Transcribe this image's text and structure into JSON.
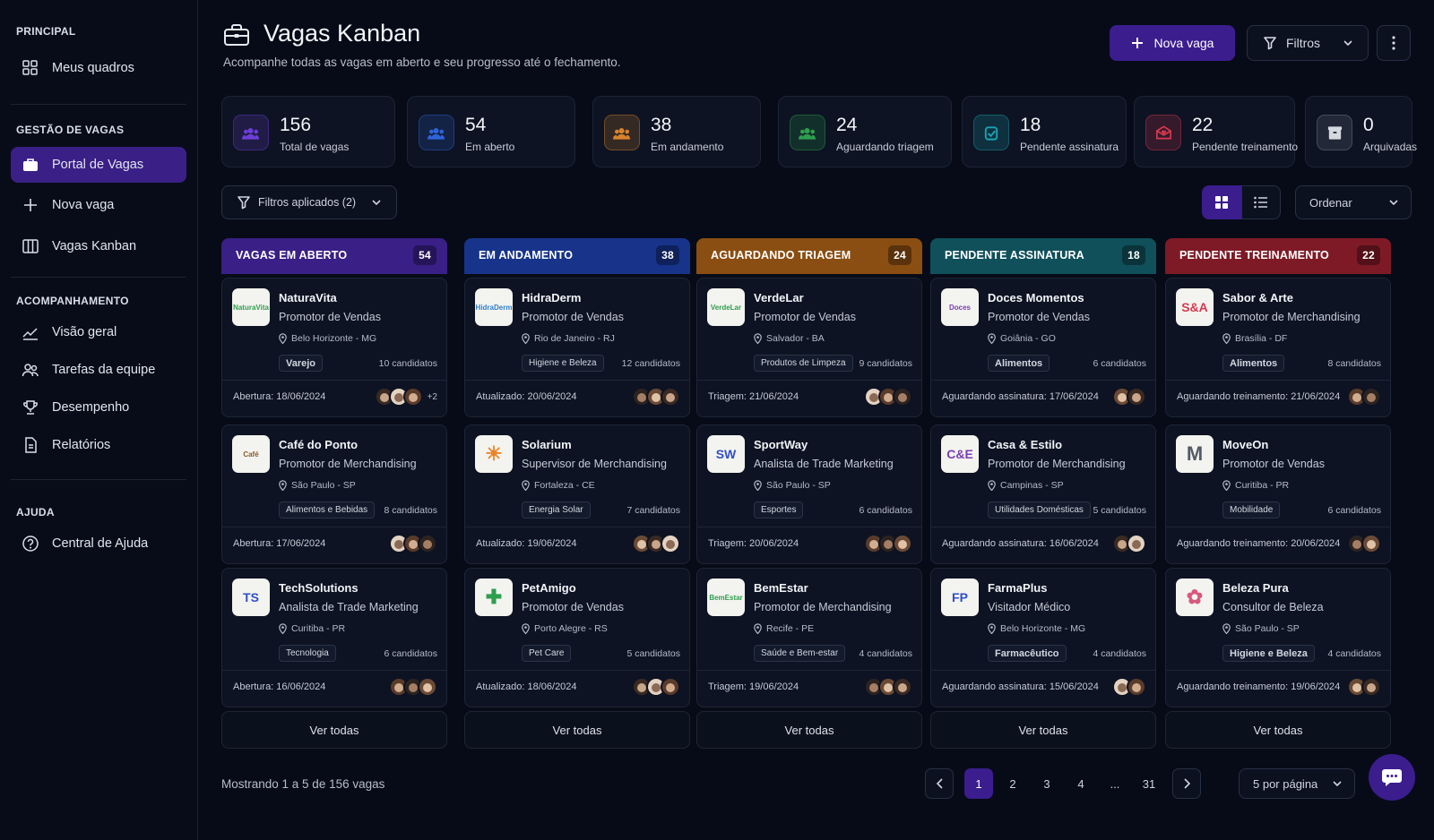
{
  "sidebar": {
    "sections": [
      {
        "title": "PRINCIPAL",
        "items": [
          {
            "label": "Meus quadros",
            "icon": "grid-icon"
          }
        ]
      },
      {
        "title": "GESTÃO DE VAGAS",
        "items": [
          {
            "label": "Portal de Vagas",
            "icon": "briefcase-icon",
            "active": true
          },
          {
            "label": "Nova vaga",
            "icon": "plus-icon"
          },
          {
            "label": "Vagas Kanban",
            "icon": "kanban-icon"
          }
        ]
      },
      {
        "title": "ACOMPANHAMENTO",
        "items": [
          {
            "label": "Visão geral",
            "icon": "chart-line-icon"
          },
          {
            "label": "Tarefas da equipe",
            "icon": "team-icon"
          },
          {
            "label": "Desempenho",
            "icon": "trophy-icon"
          },
          {
            "label": "Relatórios",
            "icon": "report-icon"
          }
        ]
      },
      {
        "title": "AJUDA",
        "items": [
          {
            "label": "Central de Ajuda",
            "icon": "help-circle-icon"
          }
        ]
      }
    ]
  },
  "header": {
    "title": "Vagas Kanban",
    "subtitle": "Acompanhe todas as vagas em aberto e seu progresso até o fechamento.",
    "new_button": "Nova vaga",
    "filter_button": "Filtros"
  },
  "stats": [
    {
      "value": "156",
      "label": "Total de vagas",
      "color": "#6c3fd6"
    },
    {
      "value": "54",
      "label": "Em aberto",
      "color": "#2f63d8"
    },
    {
      "value": "38",
      "label": "Em andamento",
      "color": "#d9822b"
    },
    {
      "value": "24",
      "label": "Aguardando triagem",
      "color": "#2e9e4f"
    },
    {
      "value": "18",
      "label": "Pendente assinatura",
      "color": "#1aa3b5"
    },
    {
      "value": "22",
      "label": "Pendente treinamento",
      "color": "#d8384f"
    },
    {
      "value": "0",
      "label": "Arquivadas",
      "color": "#7a7f8c"
    }
  ],
  "toolbar": {
    "applied_filters": "Filtros aplicados (2)",
    "sort": "Ordenar"
  },
  "columns": [
    {
      "title": "VAGAS EM ABERTO",
      "count": "54",
      "color": "#3a1f86",
      "cards": [
        {
          "company": "NaturaVita",
          "role": "Promotor de Vendas",
          "location": "Belo Horizonte - MG",
          "tag": "Varejo",
          "bold_tag": true,
          "candidates": "10 candidatos",
          "date": "Abertura: 18/06/2024",
          "extra": "+2",
          "logo_text": "NaturaVita",
          "logo_color": "#2e9e4f"
        },
        {
          "company": "Café do Ponto",
          "role": "Promotor de Merchandising",
          "location": "São Paulo - SP",
          "tag": "Alimentos e Bebidas",
          "bold_tag": false,
          "candidates": "8 candidatos",
          "date": "Abertura: 17/06/2024",
          "extra": "",
          "logo_text": "Café",
          "logo_color": "#8a5a2b"
        },
        {
          "company": "TechSolutions",
          "role": "Analista de Trade Marketing",
          "location": "Curitiba - PR",
          "tag": "Tecnologia",
          "bold_tag": false,
          "candidates": "6 candidatos",
          "date": "Abertura: 16/06/2024",
          "extra": "",
          "logo_text": "TS",
          "logo_color": "#2f4fc8"
        }
      ]
    },
    {
      "title": "EM ANDAMENTO",
      "count": "38",
      "color": "#17348a",
      "cards": [
        {
          "company": "HidraDerm",
          "role": "Promotor de Vendas",
          "location": "Rio de Janeiro - RJ",
          "tag": "Higiene e Beleza",
          "bold_tag": false,
          "candidates": "12 candidatos",
          "date": "Atualizado: 20/06/2024",
          "extra": "",
          "logo_text": "HidraDerm",
          "logo_color": "#2f7fc8"
        },
        {
          "company": "Solarium",
          "role": "Supervisor de Merchandising",
          "location": "Fortaleza - CE",
          "tag": "Energia Solar",
          "bold_tag": false,
          "candidates": "7 candidatos",
          "date": "Atualizado: 19/06/2024",
          "extra": "",
          "logo_text": "☀",
          "logo_color": "#e8862a"
        },
        {
          "company": "PetAmigo",
          "role": "Promotor de Vendas",
          "location": "Porto Alegre - RS",
          "tag": "Pet Care",
          "bold_tag": false,
          "candidates": "5 candidatos",
          "date": "Atualizado: 18/06/2024",
          "extra": "",
          "logo_text": "✚",
          "logo_color": "#2e9e4f"
        }
      ]
    },
    {
      "title": "AGUARDANDO TRIAGEM",
      "count": "24",
      "color": "#8a4e12",
      "cards": [
        {
          "company": "VerdeLar",
          "role": "Promotor de Vendas",
          "location": "Salvador - BA",
          "tag": "Produtos de Limpeza",
          "bold_tag": false,
          "candidates": "9 candidatos",
          "date": "Triagem: 21/06/2024",
          "extra": "",
          "logo_text": "VerdeLar",
          "logo_color": "#2e9e4f"
        },
        {
          "company": "SportWay",
          "role": "Analista de Trade Marketing",
          "location": "São Paulo - SP",
          "tag": "Esportes",
          "bold_tag": false,
          "candidates": "6 candidatos",
          "date": "Triagem: 20/06/2024",
          "extra": "",
          "logo_text": "SW",
          "logo_color": "#2f4fc8"
        },
        {
          "company": "BemEstar",
          "role": "Promotor de Merchandising",
          "location": "Recife - PE",
          "tag": "Saúde e Bem-estar",
          "bold_tag": false,
          "candidates": "4 candidatos",
          "date": "Triagem: 19/06/2024",
          "extra": "",
          "logo_text": "BemEstar",
          "logo_color": "#2e9e4f"
        }
      ]
    },
    {
      "title": "PENDENTE ASSINATURA",
      "count": "18",
      "color": "#10505a",
      "cards": [
        {
          "company": "Doces Momentos",
          "role": "Promotor de Vendas",
          "location": "Goiânia - GO",
          "tag": "Alimentos",
          "bold_tag": true,
          "candidates": "6 candidatos",
          "date": "Aguardando assinatura: 17/06/2024",
          "extra": "",
          "logo_text": "Doces",
          "logo_color": "#7a3fb0"
        },
        {
          "company": "Casa & Estilo",
          "role": "Promotor de Merchandising",
          "location": "Campinas - SP",
          "tag": "Utilidades Domésticas",
          "bold_tag": false,
          "candidates": "5 candidatos",
          "date": "Aguardando assinatura: 16/06/2024",
          "extra": "",
          "logo_text": "C&E",
          "logo_color": "#7a3fb0"
        },
        {
          "company": "FarmaPlus",
          "role": "Visitador Médico",
          "location": "Belo Horizonte - MG",
          "tag": "Farmacêutico",
          "bold_tag": true,
          "candidates": "4 candidatos",
          "date": "Aguardando assinatura: 15/06/2024",
          "extra": "",
          "logo_text": "FP",
          "logo_color": "#2f4fc8"
        }
      ]
    },
    {
      "title": "PENDENTE TREINAMENTO",
      "count": "22",
      "color": "#7e1a26",
      "cards": [
        {
          "company": "Sabor & Arte",
          "role": "Promotor de Merchandising",
          "location": "Brasília - DF",
          "tag": "Alimentos",
          "bold_tag": true,
          "candidates": "8 candidatos",
          "date": "Aguardando treinamento: 21/06/2024",
          "extra": "",
          "logo_text": "S&A",
          "logo_color": "#d8384f"
        },
        {
          "company": "MoveOn",
          "role": "Promotor de Vendas",
          "location": "Curitiba - PR",
          "tag": "Mobilidade",
          "bold_tag": false,
          "candidates": "6 candidatos",
          "date": "Aguardando treinamento: 20/06/2024",
          "extra": "",
          "logo_text": "M",
          "logo_color": "#555a66"
        },
        {
          "company": "Beleza Pura",
          "role": "Consultor de Beleza",
          "location": "São Paulo - SP",
          "tag": "Higiene e Beleza",
          "bold_tag": true,
          "candidates": "4 candidatos",
          "date": "Aguardando treinamento: 19/06/2024",
          "extra": "",
          "logo_text": "✿",
          "logo_color": "#d8587f"
        }
      ]
    }
  ],
  "see_all": "Ver todas",
  "footer": {
    "showing": "Mostrando 1 a 5 de 156 vagas",
    "pages": [
      "1",
      "2",
      "3",
      "4",
      "...",
      "31"
    ],
    "per_page": "5 por página"
  }
}
